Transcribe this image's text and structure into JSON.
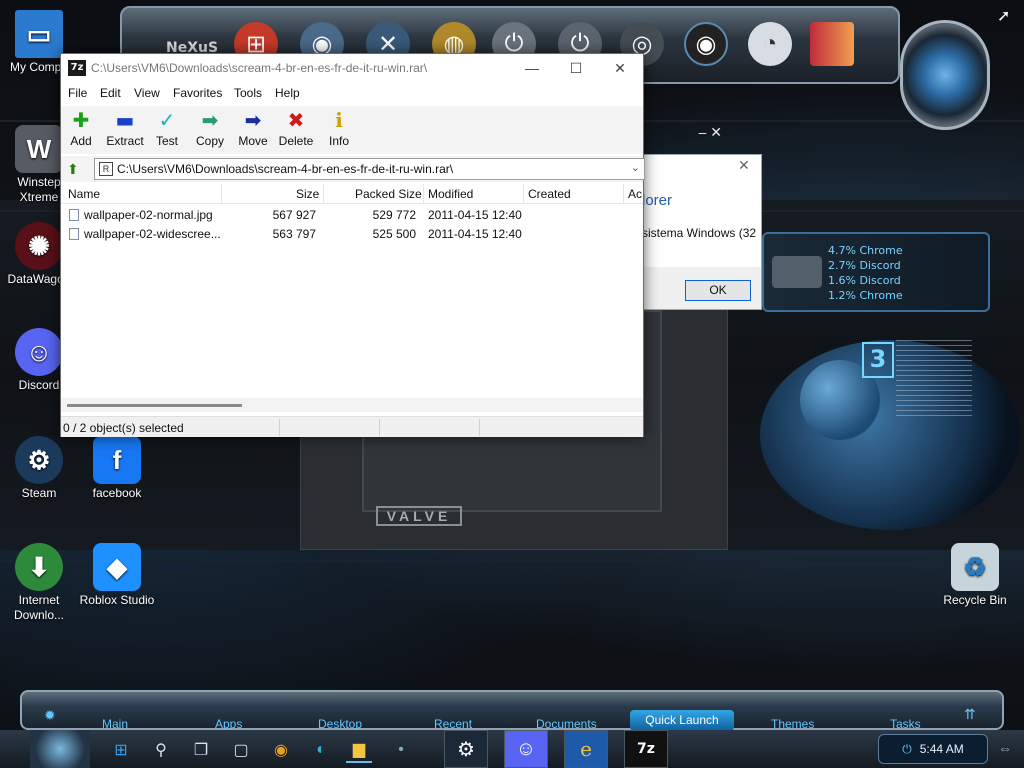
{
  "desktop": {
    "icons": [
      {
        "label": "My Compu"
      },
      {
        "label": "Winstep Xtreme"
      },
      {
        "label": "DataWagon"
      },
      {
        "label": "Discord"
      },
      {
        "label": "Steam"
      },
      {
        "label": "facebook"
      },
      {
        "label": "Internet Downlo..."
      },
      {
        "label": "Roblox Studio"
      },
      {
        "label": "Recycle Bin"
      }
    ],
    "top_dock_label": "NeXuS",
    "valve_text": "VALVE",
    "s3_text": "3",
    "net_widget": [
      "4.7% Chrome",
      "2.7% Discord",
      "1.6% Discord",
      "1.2% Chrome"
    ]
  },
  "background_dialog": {
    "title": "lorer",
    "text": "sistema Windows (32",
    "ok_label": "OK"
  },
  "window": {
    "app_icon": "7z",
    "title": "C:\\Users\\VM6\\Downloads\\scream-4-br-en-es-fr-de-it-ru-win.rar\\",
    "menu": [
      "File",
      "Edit",
      "View",
      "Favorites",
      "Tools",
      "Help"
    ],
    "toolbar": [
      {
        "label": "Add",
        "icon": "plus-icon",
        "color": "#1aa01a"
      },
      {
        "label": "Extract",
        "icon": "minus-icon",
        "color": "#1a3fc8"
      },
      {
        "label": "Test",
        "icon": "check-icon",
        "color": "#19b3b3"
      },
      {
        "label": "Copy",
        "icon": "arrow-right-icon",
        "color": "#2a9a7a"
      },
      {
        "label": "Move",
        "icon": "arrow-right-icon",
        "color": "#1a2f9e"
      },
      {
        "label": "Delete",
        "icon": "x-icon",
        "color": "#d11a1a"
      },
      {
        "label": "Info",
        "icon": "info-icon",
        "color": "#c8a400"
      }
    ],
    "address": "C:\\Users\\VM6\\Downloads\\scream-4-br-en-es-fr-de-it-ru-win.rar\\",
    "columns": [
      "Name",
      "Size",
      "Packed Size",
      "Modified",
      "Created",
      "Ac"
    ],
    "files": [
      {
        "name": "wallpaper-02-normal.jpg",
        "size": "567 927",
        "packed": "529 772",
        "modified": "2011-04-15 12:40"
      },
      {
        "name": "wallpaper-02-widescree...",
        "size": "563 797",
        "packed": "525 500",
        "modified": "2011-04-15 12:40"
      }
    ],
    "status": "0 / 2 object(s) selected"
  },
  "launch_bar": {
    "items": [
      "Main",
      "Apps",
      "Desktop",
      "Recent",
      "Documents",
      "Quick Launch",
      "Themes",
      "Tasks"
    ]
  },
  "taskbar": {
    "time": "5:44 AM"
  }
}
